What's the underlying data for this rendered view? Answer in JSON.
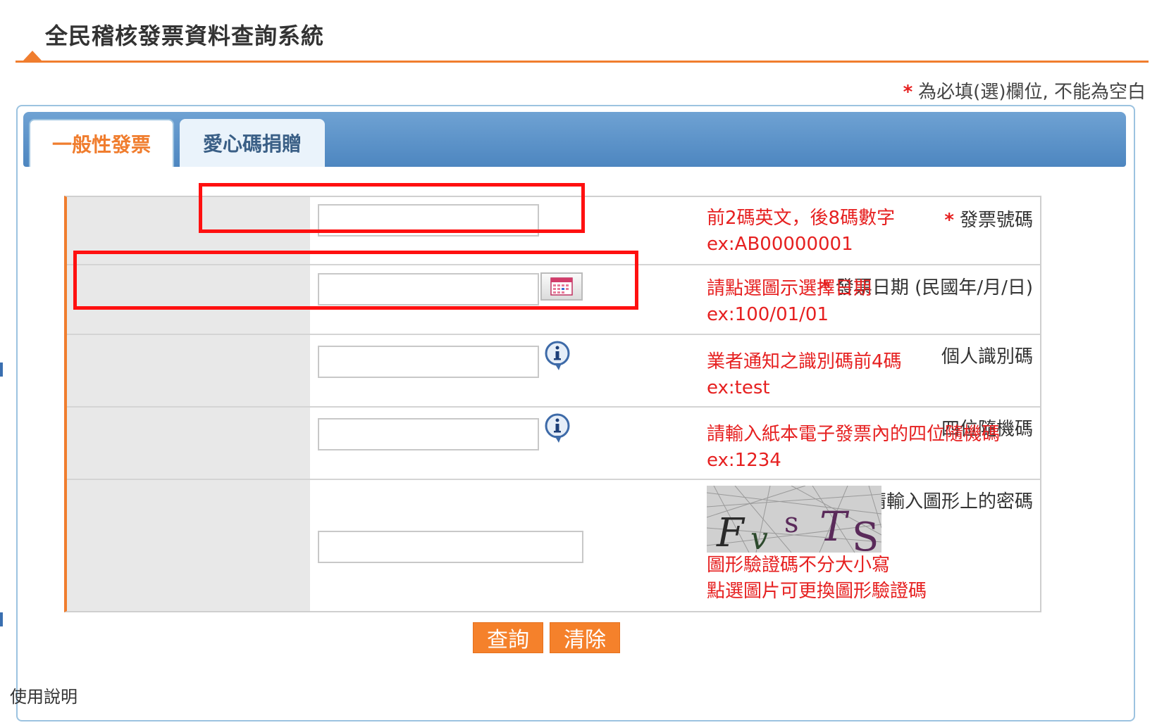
{
  "header": {
    "title": "全民稽核發票資料查詢系統"
  },
  "required_note": {
    "star": "*",
    "text": "為必填(選)欄位, 不能為空白"
  },
  "tabs": [
    {
      "label": "一般性發票",
      "active": true
    },
    {
      "label": "愛心碼捐贈",
      "active": false
    }
  ],
  "form": {
    "fields": [
      {
        "label": "發票號碼",
        "required": true,
        "value": "",
        "hint1": "前2碼英文，後8碼數字",
        "hint2": "ex:AB00000001"
      },
      {
        "label": "發票日期 (民國年/月/日)",
        "required": true,
        "value": "",
        "hint1": "請點選圖示選擇日期",
        "hint2": "ex:100/01/01"
      },
      {
        "label": "個人識別碼",
        "required": false,
        "value": "",
        "hint1": "業者通知之識別碼前4碼",
        "hint2": "ex:test"
      },
      {
        "label": "四位隨機碼",
        "required": false,
        "value": "",
        "hint1": "請輸入紙本電子發票內的四位隨機碼",
        "hint2": "ex:1234"
      },
      {
        "label": "請輸入圖形上的密碼",
        "required": true,
        "value": "",
        "hint1": "圖形驗證碼不分大小寫",
        "hint2": "點選圖片可更換圖形驗證碼"
      }
    ],
    "captcha_text": "FvsTS"
  },
  "buttons": {
    "query": "查詢",
    "clear": "清除"
  },
  "footer": {
    "text": "使用說明"
  },
  "colors": {
    "accent": "#f07d2e",
    "hint": "#e62020",
    "tab_bar": "#5b93c9",
    "highlight": "#ff1010"
  }
}
